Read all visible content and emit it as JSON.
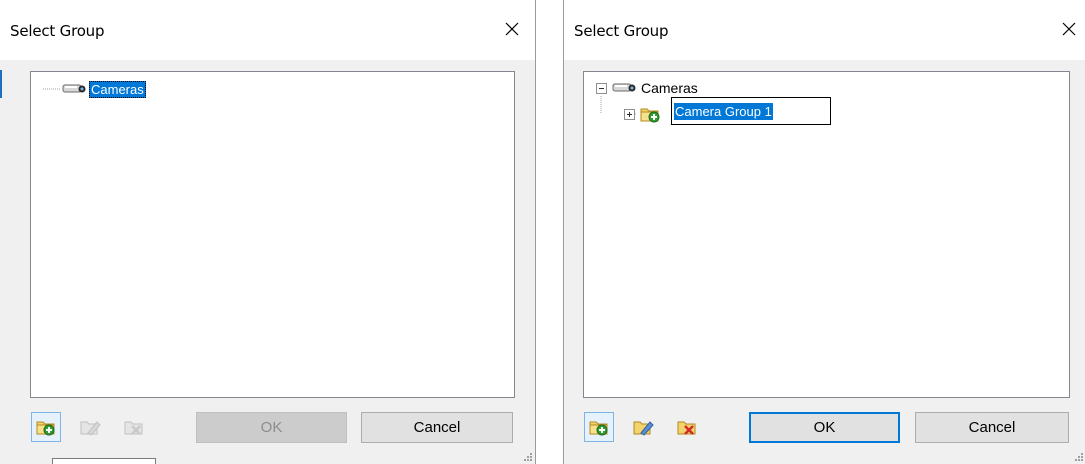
{
  "left_dialog": {
    "title": "Select Group",
    "tree": {
      "root": {
        "label": "Cameras",
        "icon": "camera-icon",
        "selected": true
      }
    },
    "toolbar": {
      "add_group_icon": "add-folder-icon",
      "rename_group_icon": "rename-folder-icon",
      "delete_group_icon": "delete-folder-icon"
    },
    "ok_label": "OK",
    "cancel_label": "Cancel"
  },
  "right_dialog": {
    "title": "Select Group",
    "tree": {
      "root": {
        "label": "Cameras",
        "icon": "camera-icon",
        "expanded": true
      },
      "child": {
        "label": "Camera Group 1",
        "icon": "add-folder-icon",
        "editing": true,
        "edit_value": "Camera Group 1"
      }
    },
    "toolbar": {
      "add_group_icon": "add-folder-icon",
      "rename_group_icon": "rename-folder-icon",
      "delete_group_icon": "delete-folder-icon"
    },
    "ok_label": "OK",
    "cancel_label": "Cancel"
  },
  "colors": {
    "selection": "#0078d7",
    "dialog_bg": "#f0f0f0",
    "titlebar_bg": "#ffffff"
  }
}
